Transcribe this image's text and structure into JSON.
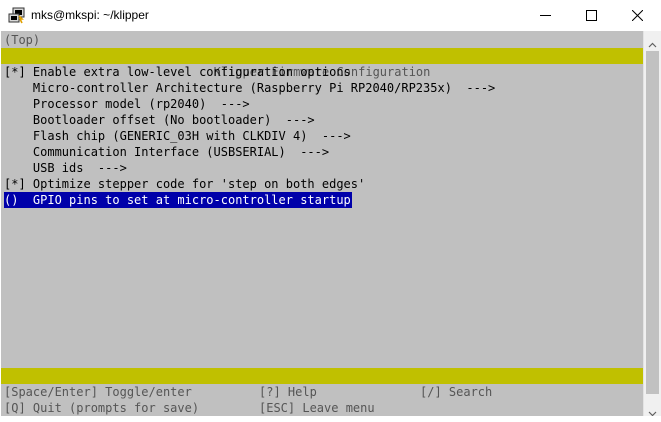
{
  "window": {
    "title": "mks@mkspi: ~/klipper"
  },
  "terminal": {
    "top_marker": "(Top)",
    "header": "Klipper Firmware Configuration",
    "items": [
      {
        "text": "[*] Enable extra low-level configuration options"
      },
      {
        "text": "    Micro-controller Architecture (Raspberry Pi RP2040/RP235x)  --->"
      },
      {
        "text": "    Processor model (rp2040)  --->"
      },
      {
        "text": "    Bootloader offset (No bootloader)  --->"
      },
      {
        "text": "    Flash chip (GENERIC_03H with CLKDIV 4)  --->"
      },
      {
        "text": "    Communication Interface (USBSERIAL)  --->"
      },
      {
        "text": "    USB ids  --->"
      },
      {
        "text": "[*] Optimize stepper code for 'step on both edges'"
      }
    ],
    "selected_item": "()  GPIO pins to set at micro-controller startup",
    "footer": {
      "toggle": "[Space/Enter] Toggle/enter",
      "help": "[?] Help",
      "search": "[/] Search",
      "quit": "[Q] Quit (prompts for save)",
      "leave": "[ESC] Leave menu"
    }
  },
  "icons": {
    "app": "putty-terminal-icon",
    "minimize": "minimize-icon",
    "maximize": "maximize-icon",
    "close": "close-icon"
  },
  "colors": {
    "terminal_bg": "#c0c0c0",
    "banner_bg": "#c0c000",
    "selection_bg": "#0000aa",
    "selection_fg": "#ffffff"
  }
}
